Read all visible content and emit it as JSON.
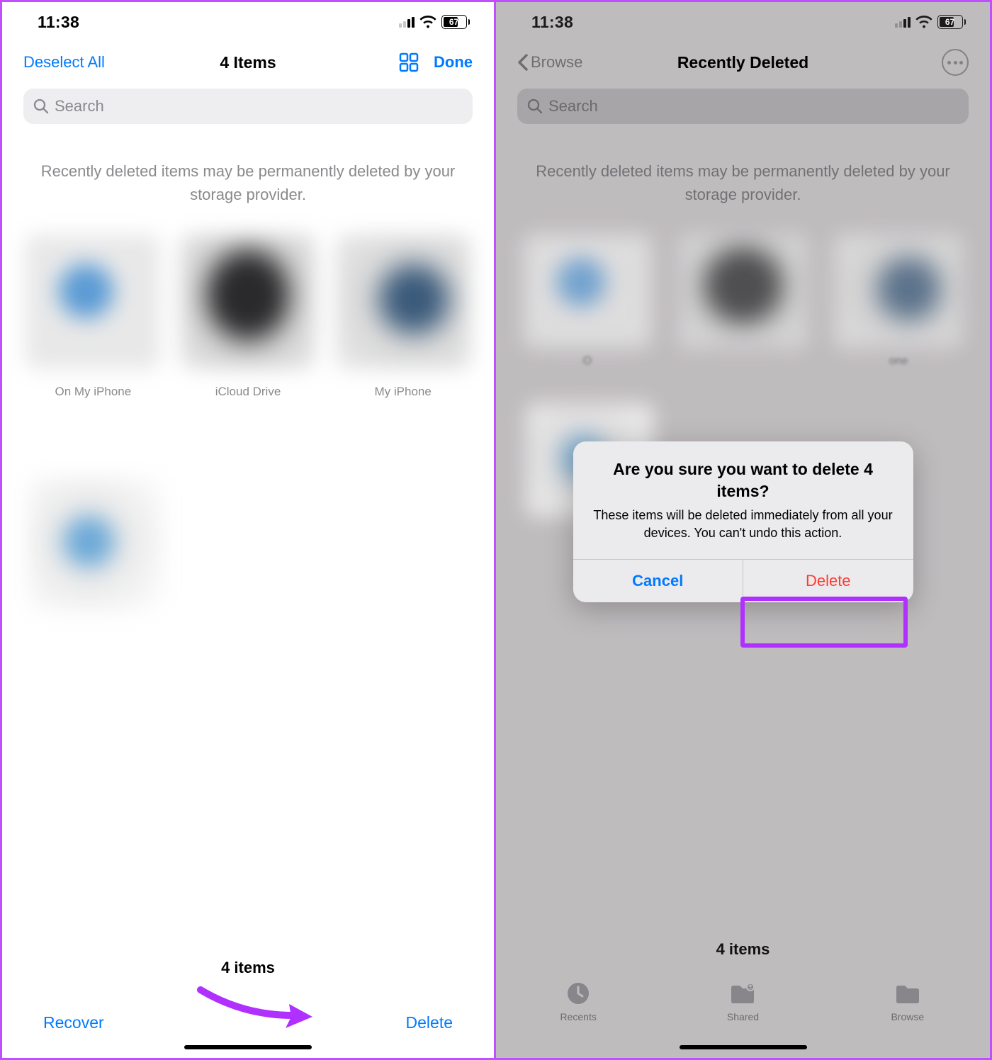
{
  "status": {
    "time": "11:38",
    "battery_level": "67",
    "battery_fill_pct": 67
  },
  "left": {
    "nav": {
      "deselect": "Deselect All",
      "title": "4 Items",
      "done": "Done"
    },
    "search_placeholder": "Search",
    "notice": "Recently deleted items may be permanently deleted by your storage provider.",
    "thumbs": [
      {
        "label": "On My iPhone"
      },
      {
        "label": "iCloud Drive"
      },
      {
        "label": "My iPhone"
      }
    ],
    "footer": {
      "count": "4 items",
      "recover": "Recover",
      "delete": "Delete"
    }
  },
  "right": {
    "nav": {
      "back": "Browse",
      "title": "Recently Deleted"
    },
    "search_placeholder": "Search",
    "notice": "Recently deleted items may be permanently deleted by your storage provider.",
    "thumbs": [
      {
        "label": "O"
      },
      {
        "label": ""
      },
      {
        "label": "one"
      }
    ],
    "footer": {
      "count": "4 items"
    },
    "tabs": [
      {
        "label": "Recents"
      },
      {
        "label": "Shared"
      },
      {
        "label": "Browse"
      }
    ],
    "modal": {
      "title": "Are you sure you want to delete 4 items?",
      "message": "These items will be deleted immediately from all your devices. You can't undo this action.",
      "cancel": "Cancel",
      "delete": "Delete"
    }
  }
}
